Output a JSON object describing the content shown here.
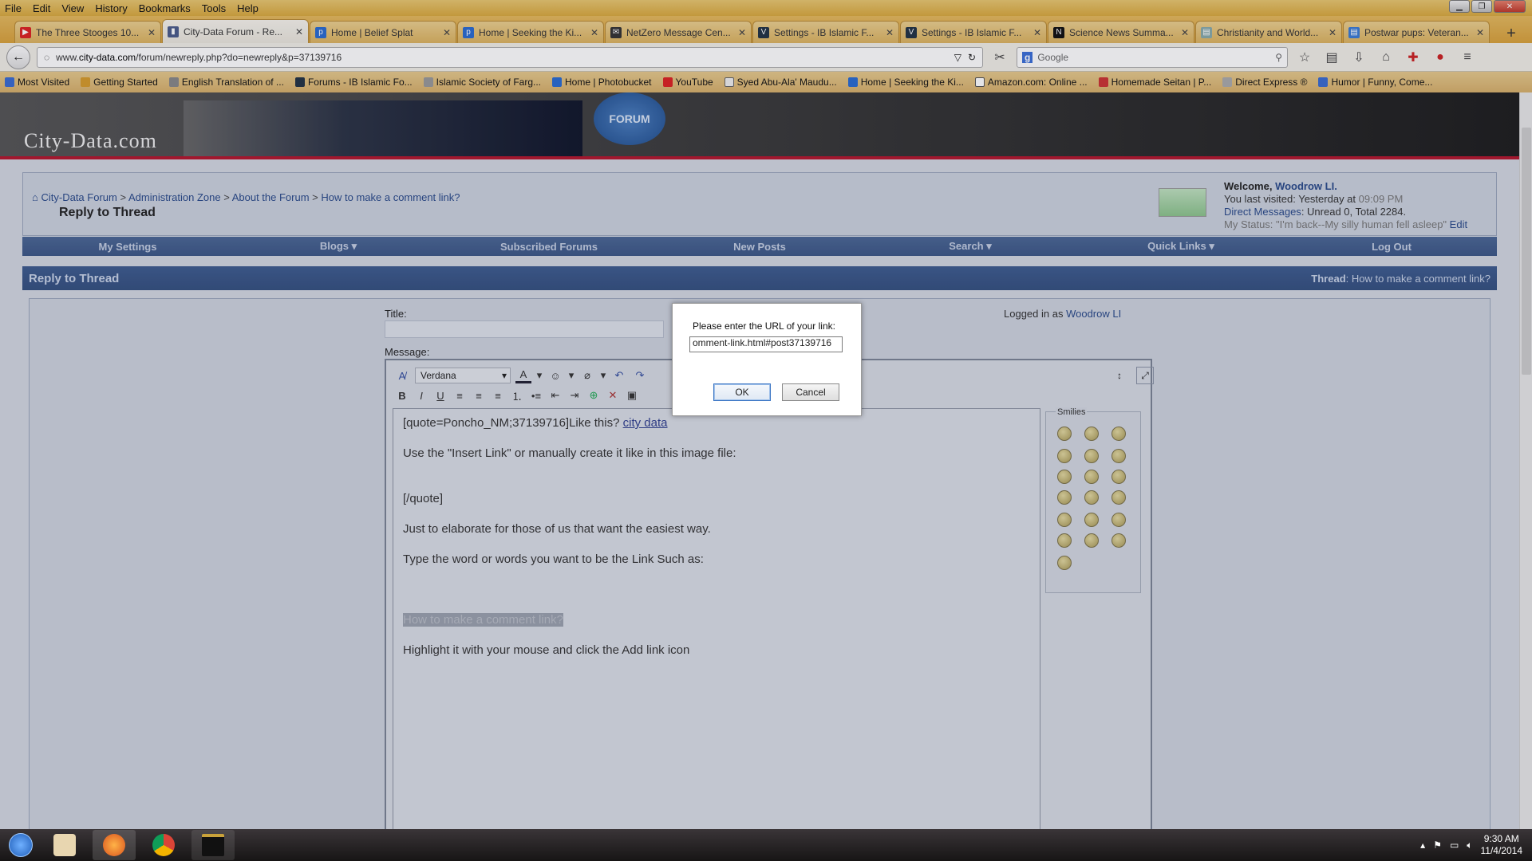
{
  "menubar": [
    "File",
    "Edit",
    "View",
    "History",
    "Bookmarks",
    "Tools",
    "Help"
  ],
  "tabs": [
    {
      "title": "The Three Stooges 10..."
    },
    {
      "title": "City-Data Forum - Re...",
      "active": true
    },
    {
      "title": "Home | Belief Splat"
    },
    {
      "title": "Home | Seeking the Ki..."
    },
    {
      "title": "NetZero Message Cen..."
    },
    {
      "title": "Settings - IB Islamic F..."
    },
    {
      "title": "Settings - IB Islamic F..."
    },
    {
      "title": "Science News Summa..."
    },
    {
      "title": "Christianity and World..."
    },
    {
      "title": "Postwar pups: Veteran..."
    }
  ],
  "address": {
    "prefix": "www.",
    "domain": "city-data.com",
    "path": "/forum/newreply.php?do=newreply&p=37139716"
  },
  "search": {
    "placeholder": "Google"
  },
  "bookmarks": [
    "Most Visited",
    "Getting Started",
    "English Translation of ...",
    "Forums - IB Islamic Fo...",
    "Islamic Society of Farg...",
    "Home | Photobucket",
    "YouTube",
    "Syed Abu-Ala' Maudu...",
    "Home | Seeking the Ki...",
    "Amazon.com: Online ...",
    "Homemade Seitan | P...",
    "Direct Express ®",
    "Humor | Funny, Come..."
  ],
  "site": {
    "logo": "City-Data.com",
    "badge": "FORUM"
  },
  "breadcrumb": {
    "items": [
      "City-Data Forum",
      "Administration Zone",
      "About the Forum",
      "How to make a comment link?"
    ],
    "sep": ">",
    "current": "Reply to Thread"
  },
  "welcome": {
    "label": "Welcome,",
    "user": "Woodrow LI.",
    "last_visit_label": "You last visited: Yesterday at",
    "last_visit_time": "09:09 PM",
    "dm_label": "Direct Messages",
    "dm_value": ": Unread 0, Total 2284.",
    "status_label": "My Status:",
    "status_text": "\"I'm back--My silly human fell asleep\"",
    "status_edit": "Edit"
  },
  "nav": [
    "My Settings",
    "Blogs ▾",
    "Subscribed Forums",
    "New Posts",
    "Search ▾",
    "Quick Links ▾",
    "Log Out"
  ],
  "panel": {
    "title": "Reply to Thread",
    "thread_label": "Thread",
    "thread_value": ": How to make a comment link?"
  },
  "form": {
    "title_label": "Title:",
    "message_label": "Message:",
    "logged_label": "Logged in as",
    "logged_user": "Woodrow LI"
  },
  "editor": {
    "font": "Verdana",
    "smilies_label": "Smilies"
  },
  "message": {
    "quote_open": "[quote=Poncho_NM;37139716]Like this?",
    "quote_link": "city data",
    "line2": "Use the \"Insert Link\" or manually create it like in this image file:",
    "quote_close": "[/quote]",
    "line4": "Just to elaborate for those of us that want the easiest way.",
    "line5": "Type the word or words you want to be the Link Such as:",
    "highlighted": "How to make a comment link?",
    "line7": "Highlight it with your mouse and  click the Add link icon"
  },
  "dialog": {
    "message": "Please enter the URL of your link:",
    "value": "omment-link.html#post37139716",
    "ok": "OK",
    "cancel": "Cancel"
  },
  "taskbar": {
    "time": "9:30 AM",
    "date": "11/4/2014"
  }
}
